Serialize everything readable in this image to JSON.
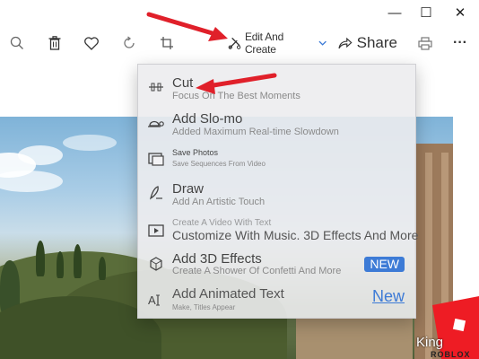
{
  "window": {
    "minimize_glyph": "—",
    "maximize_glyph": "☐",
    "close_glyph": "✕"
  },
  "toolbar": {
    "zoom_icon": "zoom-in-icon",
    "delete_icon": "trash-icon",
    "favorite_icon": "heart-icon",
    "rotate_icon": "rotate-icon",
    "crop_icon": "crop-icon",
    "edit_label": "Edit And Create",
    "share_label": "Share",
    "print_icon": "print-icon",
    "more_glyph": "···"
  },
  "menu": {
    "items": [
      {
        "icon": "trim-icon",
        "title": "Cut",
        "subtitle": "Focus On The Best Moments"
      },
      {
        "icon": "turtle-icon",
        "title": "Add Slo-mo",
        "subtitle": "Added Maximum Real-time Slowdown"
      },
      {
        "icon": "save-photo-icon",
        "title": "Save Photos",
        "subtitle": "Save Sequences From Video"
      },
      {
        "icon": "pen-icon",
        "title": "Draw",
        "subtitle": "Add An Artistic Touch"
      },
      {
        "icon": "video-text-icon",
        "ghost": "Create A Video With Text",
        "title": "Customize With Music. 3D Effects And More"
      },
      {
        "icon": "sparkle-3d-icon",
        "title": "Add 3D Effects",
        "subtitle": "Create A Shower Of Confetti And More",
        "badge": "NEW"
      },
      {
        "icon": "animated-text-icon",
        "title": "Add Animated Text",
        "subtitle": "Make, Titles Appear",
        "badge": "New"
      }
    ]
  },
  "watermark": {
    "king": "King",
    "roblox": "ROBLOX"
  },
  "colors": {
    "arrow": "#e0202a",
    "accent": "#3d7bd6",
    "logo": "#ee1c24"
  }
}
